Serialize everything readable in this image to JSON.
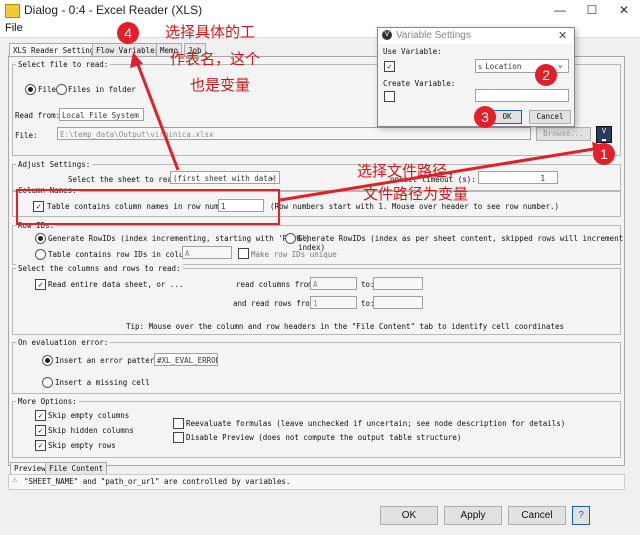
{
  "window": {
    "title": "Dialog - 0:4 - Excel Reader (XLS)",
    "min": "—",
    "max": "☐",
    "close": "✕"
  },
  "menu": {
    "file": "File"
  },
  "tabs": [
    "XLS Reader Settings",
    "Flow Variables",
    "Memo",
    "Job"
  ],
  "file_section": {
    "legend": "Select file to read:",
    "radio_file": "File",
    "radio_folder": "Files in folder",
    "read_from_label": "Read from:",
    "read_from_value": "Local File System",
    "file_label": "File:",
    "file_value": "E:\\temp_data\\Output\\virginica.xlsx",
    "browse": "Browse..."
  },
  "adjust": {
    "legend": "Adjust Settings:",
    "sheet_label": "Select the sheet to read:",
    "sheet_value": "(first sheet with data)",
    "timeout_label": "onnect timeout (s):",
    "timeout_value": "1"
  },
  "column_names": {
    "legend": "Column Names:",
    "checkbox_label": "Table contains column names in row number:",
    "row_value": "1",
    "hint": "(Row numbers start with 1. Mouse over header to see row number.)"
  },
  "row_ids": {
    "legend": "Row IDs:",
    "opt1": "Generate RowIDs (index incrementing, starting with 'Row0')",
    "opt2": "Generate RowIDs (index as per sheet content, skipped rows will increment index)",
    "opt3": "Table contains row IDs in column:",
    "col_value": "A",
    "unique": "Make row IDs unique"
  },
  "select_cols": {
    "legend": "Select the columns and rows to read:",
    "read_entire": "Read entire data sheet, or ...",
    "read_cols": "read columns from:",
    "cols_from": "A",
    "to1": "to:",
    "read_rows": "and read rows from:",
    "rows_from": "1",
    "to2": "to:",
    "tip": "Tip: Mouse over the column and row headers in the \"File Content\" tab to identify cell coordinates"
  },
  "eval": {
    "legend": "On evaluation error:",
    "insert_pattern": "Insert an error pattern:",
    "pattern_value": "#XL_EVAL_ERROR#",
    "insert_missing": "Insert a missing cell"
  },
  "more": {
    "legend": "More Options:",
    "skip_cols": "Skip empty columns",
    "skip_hidden": "Skip hidden columns",
    "skip_rows": "Skip empty rows",
    "reevaluate": "Reevaluate formulas (leave unchecked if uncertain; see node description for details)",
    "disable_preview": "Disable Preview  (does not compute the output table structure)"
  },
  "bottom_tabs": [
    "Preview",
    "File Content"
  ],
  "status": "\"SHEET_NAME\" and \"path_or_url\" are controlled by variables.",
  "buttons": {
    "ok": "OK",
    "apply": "Apply",
    "cancel": "Cancel",
    "help": "?"
  },
  "variable_dialog": {
    "title": "Variable Settings",
    "use_variable": "Use Variable:",
    "variable_value": "Location",
    "create_variable": "Create Variable:",
    "ok": "OK",
    "cancel": "Cancel"
  },
  "annotations": {
    "a1": "选择具体的工",
    "a2": "作表名，这个",
    "a3": "也是变量",
    "b1": "选择文件路径，",
    "b2": "文件路径为变量",
    "n1": "1",
    "n2": "2",
    "n3": "3",
    "n4": "4"
  }
}
